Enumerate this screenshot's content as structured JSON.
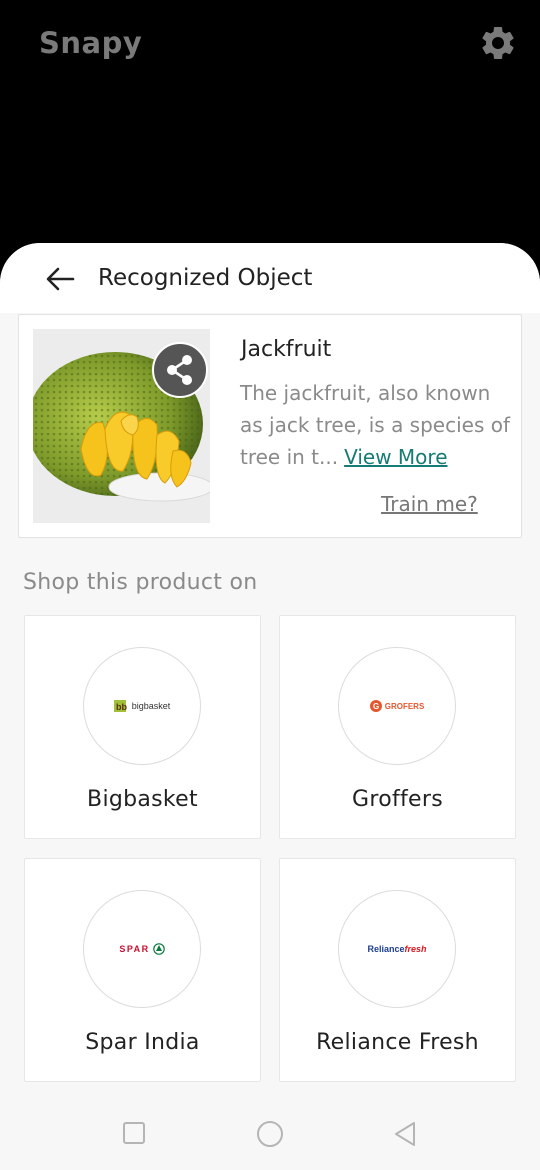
{
  "app": {
    "title": "Snapy"
  },
  "sheet": {
    "title": "Recognized Object"
  },
  "result": {
    "name": "Jackfruit",
    "description": "The jackfruit, also known as jack tree, is a species of tree in t...",
    "view_more": "View More",
    "train": "Train me?"
  },
  "shop": {
    "label": "Shop this product on",
    "stores": [
      {
        "name": "Bigbasket",
        "logo_text": "bigbasket",
        "logo_icon": "bb-logo-icon"
      },
      {
        "name": "Groffers",
        "logo_text": "GROFERS",
        "logo_icon": "grofers-logo-icon"
      },
      {
        "name": "Spar India",
        "logo_text": "SPAR",
        "logo_icon": "spar-logo-icon"
      },
      {
        "name": "Reliance Fresh",
        "logo_text_a": "Reliance",
        "logo_text_b": "fresh",
        "logo_icon": "reliance-logo-icon"
      }
    ]
  },
  "icons": {
    "settings": "gear-icon",
    "back": "arrow-left-icon",
    "share": "share-icon",
    "nav_recent": "square-icon",
    "nav_home": "circle-icon",
    "nav_back": "triangle-back-icon"
  },
  "colors": {
    "accent": "#167b74",
    "grofers": "#e4572e",
    "spar": "#c8102e",
    "reliance_red": "#d71920",
    "reliance_blue": "#1b3e8f"
  }
}
